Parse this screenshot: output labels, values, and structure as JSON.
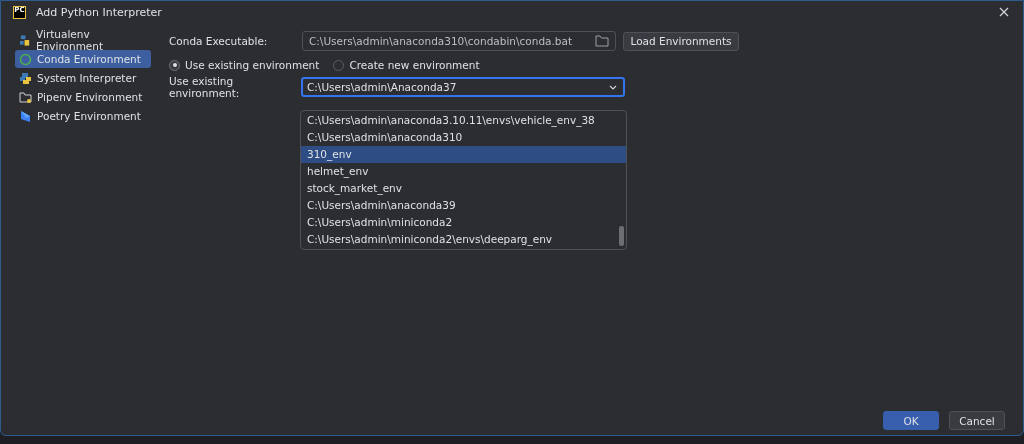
{
  "window": {
    "title": "Add Python Interpreter",
    "app_icon": "PC"
  },
  "sidebar": {
    "items": [
      {
        "label": "Virtualenv Environment",
        "kind": "virtualenv",
        "selected": false
      },
      {
        "label": "Conda Environment",
        "kind": "conda",
        "selected": true
      },
      {
        "label": "System Interpreter",
        "kind": "python",
        "selected": false
      },
      {
        "label": "Pipenv Environment",
        "kind": "pipenv",
        "selected": false
      },
      {
        "label": "Poetry Environment",
        "kind": "poetry",
        "selected": false
      }
    ]
  },
  "conda_executable": {
    "label": "Conda Executable:",
    "value": "C:\\Users\\admin\\anaconda310\\condabin\\conda.bat",
    "button": "Load Environments"
  },
  "mode": [
    {
      "label": "Use existing environment",
      "selected": true
    },
    {
      "label": "Create new environment",
      "selected": false
    }
  ],
  "existing_environment": {
    "label": "Use existing environment:",
    "value": "C:\\Users\\admin\\Anaconda37",
    "options": [
      {
        "label": "C:\\Users\\admin\\anaconda3.10.11\\envs\\vehicle_env_38",
        "selected": false
      },
      {
        "label": "C:\\Users\\admin\\anaconda310",
        "selected": false
      },
      {
        "label": "310_env",
        "selected": true
      },
      {
        "label": "helmet_env",
        "selected": false
      },
      {
        "label": "stock_market_env",
        "selected": false
      },
      {
        "label": "C:\\Users\\admin\\anaconda39",
        "selected": false
      },
      {
        "label": "C:\\Users\\admin\\miniconda2",
        "selected": false
      },
      {
        "label": "C:\\Users\\admin\\miniconda2\\envs\\deeparg_env",
        "selected": false
      }
    ]
  },
  "buttons": [
    {
      "label": "OK",
      "kind": "primary"
    },
    {
      "label": "Cancel",
      "kind": "secondary"
    }
  ]
}
